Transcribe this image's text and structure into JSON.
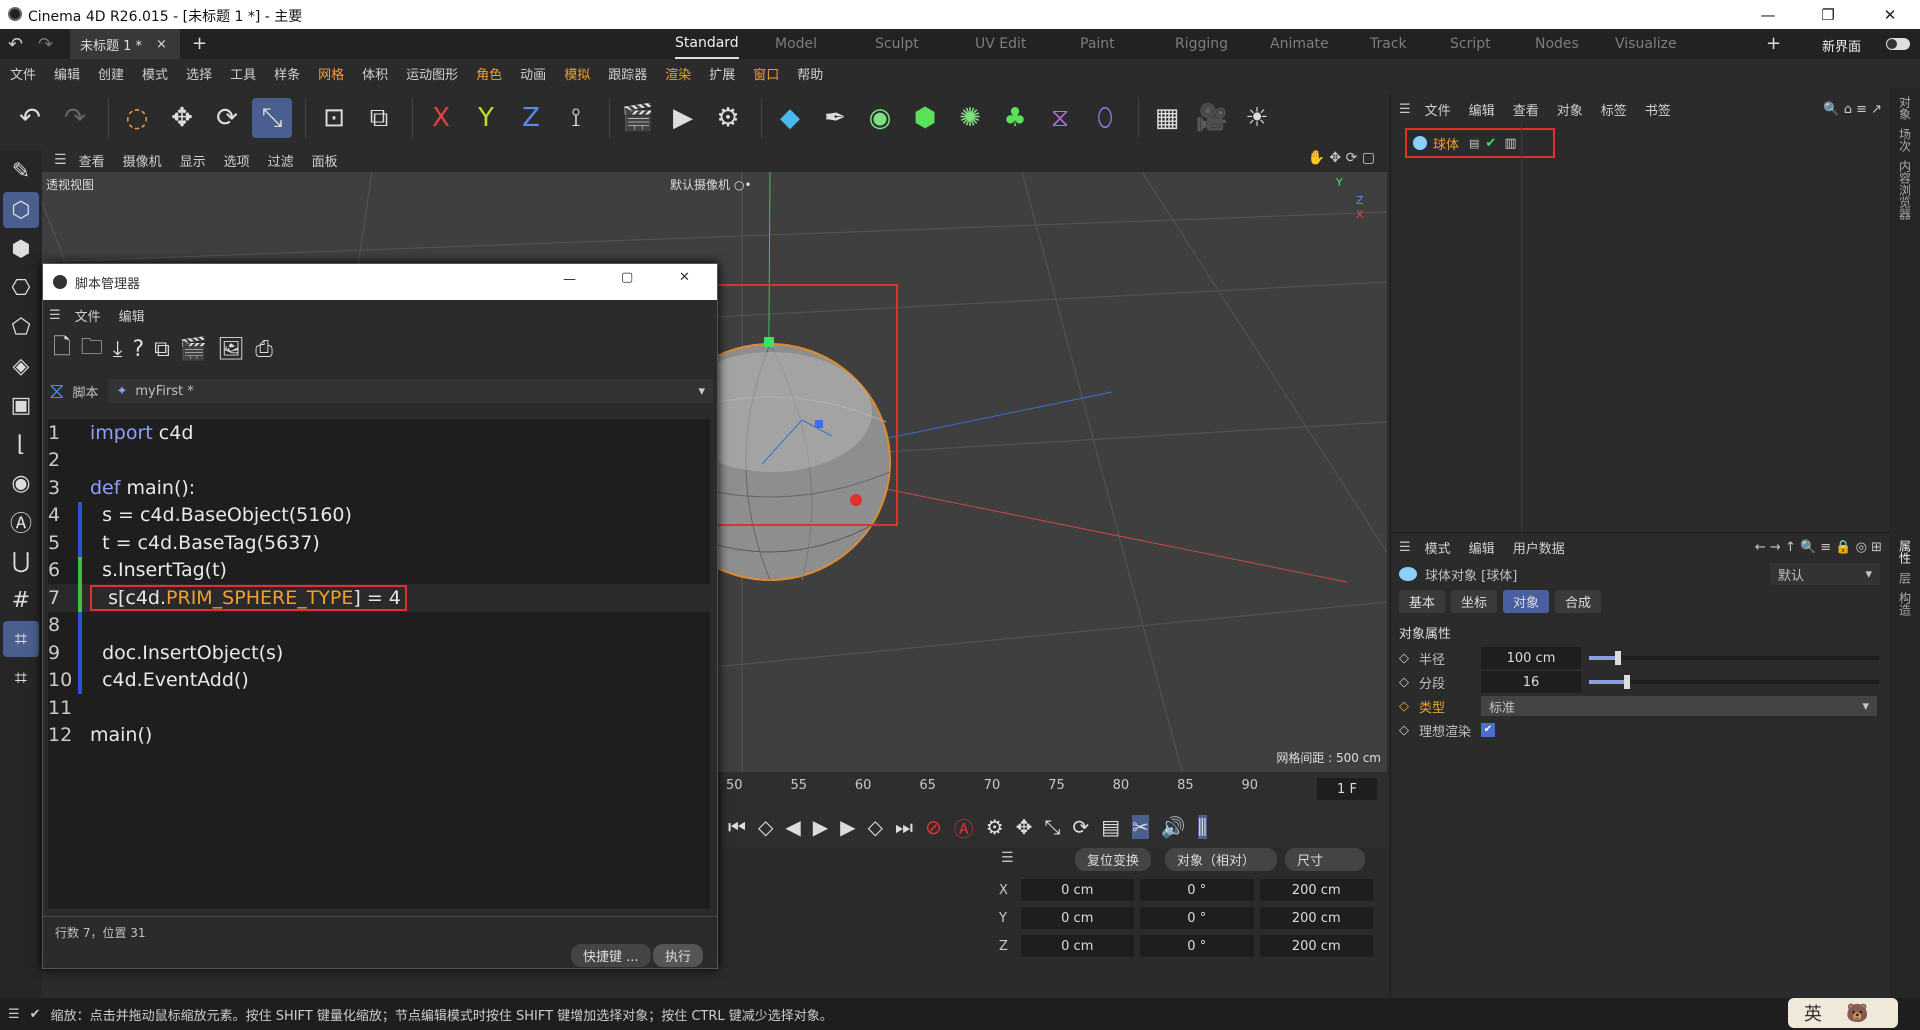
{
  "window": {
    "title": "Cinema 4D R26.015 - [未标题 1 *] - 主要",
    "minimize": "—",
    "maximize": "❐",
    "close": "✕"
  },
  "tabs": {
    "doc": "未标题 1 *",
    "close": "×",
    "add": "+",
    "layouts": [
      "Standard",
      "Model",
      "Sculpt",
      "UV Edit",
      "Paint",
      "Rigging",
      "Animate",
      "Track",
      "Script",
      "Nodes",
      "Visualize"
    ],
    "active": "Standard",
    "plus": "+",
    "newui": "新界面"
  },
  "menu": {
    "items": [
      "文件",
      "编辑",
      "创建",
      "模式",
      "选择",
      "工具",
      "样条",
      "网格",
      "体积",
      "运动图形",
      "角色",
      "动画",
      "模拟",
      "跟踪器",
      "渲染",
      "扩展",
      "窗口",
      "帮助"
    ],
    "accents": [
      "网格",
      "角色",
      "模拟",
      "渲染",
      "窗口"
    ]
  },
  "toolbar": {
    "icons": [
      "undo",
      "redo",
      "live-select",
      "move",
      "rotate",
      "scale",
      "snap",
      "axis",
      "model",
      "x-axis",
      "y-axis",
      "z-axis",
      "coord",
      "render-region",
      "render-view",
      "render-settings",
      "cube",
      "pen",
      "subdivide",
      "extrude",
      "cloner",
      "mograph",
      "deformer",
      "field",
      "grid",
      "camera",
      "light"
    ]
  },
  "viewport": {
    "menu": [
      "查看",
      "摄像机",
      "显示",
      "选项",
      "过滤",
      "面板"
    ],
    "label": "透视视图",
    "camera": "默认摄像机",
    "camera_icon": "○•",
    "grid_spacing": "网格间距 : 500 cm",
    "axis": {
      "y": "Y",
      "z": "Z",
      "x": "X"
    }
  },
  "timeline": {
    "ticks": [
      "50",
      "55",
      "60",
      "65",
      "70",
      "75",
      "80",
      "85",
      "90"
    ],
    "frame": "1 F"
  },
  "coord": {
    "reset": "复位变换",
    "mode": "对象（相对）",
    "size": "尺寸",
    "rows": [
      {
        "axis": "X",
        "pos": "0 cm",
        "rot": "0 °",
        "size": "200 cm"
      },
      {
        "axis": "Y",
        "pos": "0 cm",
        "rot": "0 °",
        "size": "200 cm"
      },
      {
        "axis": "Z",
        "pos": "0 cm",
        "rot": "0 °",
        "size": "200 cm"
      }
    ]
  },
  "objects": {
    "menu": [
      "文件",
      "编辑",
      "查看",
      "对象",
      "标签",
      "书签"
    ],
    "item": "球体"
  },
  "attributes": {
    "menu": [
      "模式",
      "编辑",
      "用户数据"
    ],
    "object": "球体对象 [球体]",
    "preset": "默认",
    "tabs": [
      "基本",
      "坐标",
      "对象",
      "合成"
    ],
    "active_tab": "对象",
    "section": "对象属性",
    "props": [
      {
        "label": "半径",
        "value": "100 cm",
        "slider": 0.1
      },
      {
        "label": "分段",
        "value": "16",
        "slider": 0.13
      }
    ],
    "type_label": "类型",
    "type_value": "标准",
    "render_label": "理想渲染"
  },
  "rightstrip": [
    "对象",
    "场次",
    "内容浏览器",
    "属性",
    "层",
    "构造"
  ],
  "script": {
    "title": "脚本管理器",
    "menu": [
      "文件",
      "编辑"
    ],
    "lang": "脚本",
    "file": "myFirst *",
    "status": "行数 7，位置 31",
    "shortcut": "快捷键 ...",
    "run": "执行",
    "lines": [
      {
        "n": "1",
        "parts": [
          [
            "kw",
            "import"
          ],
          [
            "",
            "c4d"
          ]
        ]
      },
      {
        "n": "2",
        "parts": []
      },
      {
        "n": "3",
        "parts": [
          [
            "kw",
            "def"
          ],
          [
            "",
            "main():"
          ]
        ]
      },
      {
        "n": "4",
        "parts": [
          [
            "",
            "  s = c4d.BaseObject(5160)"
          ]
        ]
      },
      {
        "n": "5",
        "parts": [
          [
            "",
            "  t = c4d.BaseTag(5637)"
          ]
        ]
      },
      {
        "n": "6",
        "parts": [
          [
            "",
            "  s.InsertTag(t)"
          ]
        ]
      },
      {
        "n": "7",
        "parts": [
          [
            "",
            "  s[c4d."
          ],
          [
            "or",
            "PRIM_SPHERE_TYPE"
          ],
          [
            "",
            "] = 4"
          ]
        ]
      },
      {
        "n": "8",
        "parts": []
      },
      {
        "n": "9",
        "parts": [
          [
            "",
            "  doc.InsertObject(s)"
          ]
        ]
      },
      {
        "n": "10",
        "parts": [
          [
            "",
            "  c4d.EventAdd()"
          ]
        ]
      },
      {
        "n": "11",
        "parts": []
      },
      {
        "n": "12",
        "parts": [
          [
            "",
            "main()"
          ]
        ]
      }
    ]
  },
  "status": {
    "text": "缩放：点击并拖动鼠标缩放元素。按住 SHIFT 键量化缩放；节点编辑模式时按住 SHIFT 键增加选择对象；按住 CTRL 键减少选择对象。",
    "ime": "英"
  }
}
